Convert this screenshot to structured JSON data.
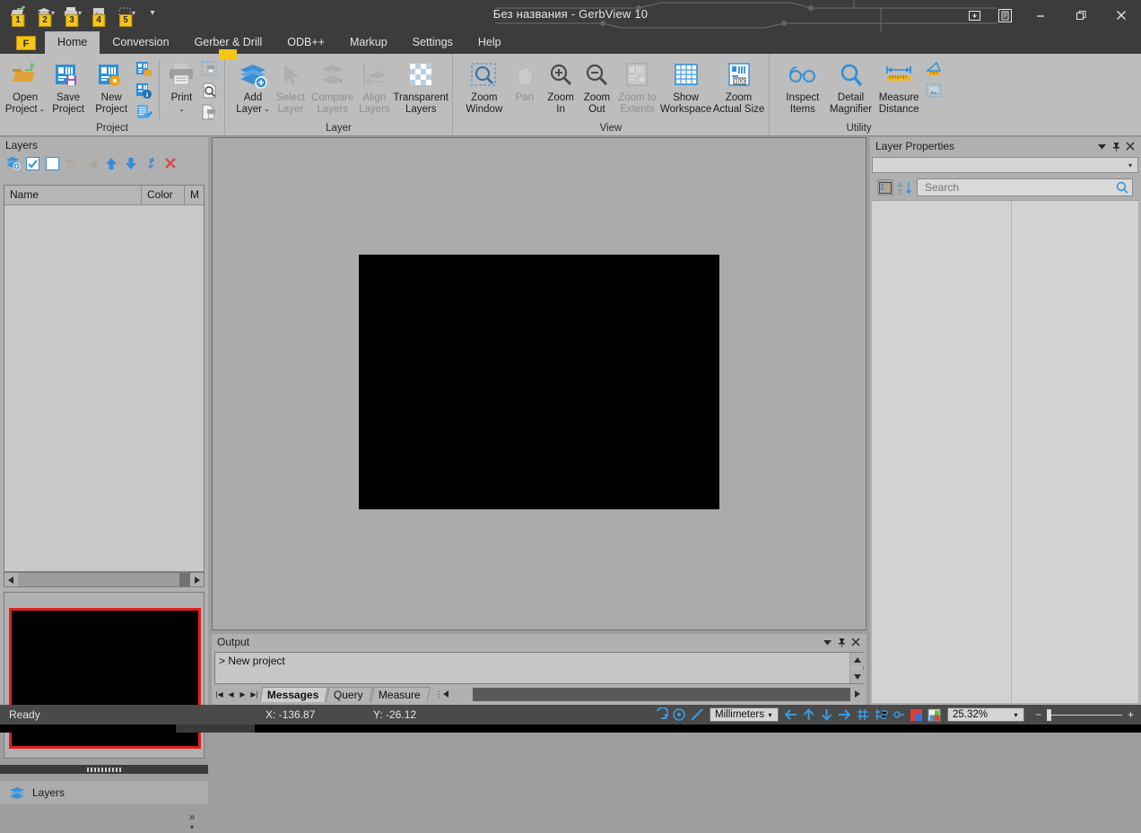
{
  "window": {
    "title": "Без названия - GerbView 10",
    "quick_access": [
      {
        "name": "open",
        "keytip": "1",
        "icon": "open-folder-icon",
        "has_caret": false
      },
      {
        "name": "save",
        "keytip": "2",
        "icon": "save-layers-icon",
        "has_caret": true
      },
      {
        "name": "print",
        "keytip": "3",
        "icon": "printer-icon",
        "has_caret": true
      },
      {
        "name": "export",
        "keytip": "4",
        "icon": "export-image-icon",
        "has_caret": false
      },
      {
        "name": "select",
        "keytip": "5",
        "icon": "select-rect-icon",
        "has_caret": true
      },
      {
        "name": "customize",
        "keytip": "",
        "icon": "chevron-down-icon",
        "has_caret": false
      }
    ],
    "controls": {
      "ribbon_display": "ribbon-display-icon",
      "ribbon_pin": "ribbon-pin-icon",
      "minimize": "minimize-icon",
      "restore": "restore-icon",
      "close": "close-icon"
    }
  },
  "ribbon": {
    "file_keytip": "F",
    "tabs": [
      {
        "label": "Home",
        "active": true,
        "keytip": ""
      },
      {
        "label": "Conversion",
        "active": false,
        "keytip": ""
      },
      {
        "label": "Gerber & Drill",
        "active": false,
        "keytip": ""
      },
      {
        "label": "ODB++",
        "active": false,
        "keytip": ""
      },
      {
        "label": "Markup",
        "active": false,
        "keytip": ""
      },
      {
        "label": "Settings",
        "active": false,
        "keytip": ""
      },
      {
        "label": "Help",
        "active": false,
        "keytip": ""
      }
    ],
    "groups": [
      {
        "title": "Project",
        "buttons": [
          {
            "label": "Open\nProject",
            "line1": "Open",
            "line2": "Project",
            "icon": "open-project-icon",
            "caret": true,
            "disabled": false
          },
          {
            "label": "Save Project",
            "line1": "Save",
            "line2": "Project",
            "icon": "save-project-icon",
            "caret": false,
            "disabled": false
          },
          {
            "label": "New Project",
            "line1": "New",
            "line2": "Project",
            "icon": "new-project-icon",
            "caret": false,
            "disabled": false
          }
        ],
        "small_buttons": [
          "project-files-icon",
          "project-info-icon",
          "project-notes-icon"
        ],
        "buttons2": [
          {
            "line1": "Print",
            "line2": "",
            "icon": "print-icon",
            "caret": true,
            "disabled": false
          }
        ],
        "small_buttons2": [
          "print-area-icon",
          "print-preview-icon",
          "print-to-file-icon"
        ]
      },
      {
        "title": "Layer",
        "buttons": [
          {
            "line1": "Add",
            "line2": "Layer",
            "icon": "add-layer-icon",
            "caret": true,
            "disabled": false
          },
          {
            "line1": "Select",
            "line2": "Layer",
            "icon": "select-layer-icon",
            "caret": false,
            "disabled": true
          },
          {
            "line1": "Compare",
            "line2": "Layers",
            "icon": "compare-layers-icon",
            "caret": false,
            "disabled": true
          },
          {
            "line1": "Align",
            "line2": "Layers",
            "icon": "align-layers-icon",
            "caret": false,
            "disabled": true
          },
          {
            "line1": "Transparent",
            "line2": "Layers",
            "icon": "transparent-layers-icon",
            "caret": false,
            "disabled": false
          }
        ]
      },
      {
        "title": "View",
        "buttons": [
          {
            "line1": "Zoom",
            "line2": "Window",
            "icon": "zoom-window-icon",
            "caret": false,
            "disabled": false
          },
          {
            "line1": "Pan",
            "line2": "",
            "icon": "pan-hand-icon",
            "caret": false,
            "disabled": true
          },
          {
            "line1": "Zoom",
            "line2": "In",
            "icon": "zoom-in-icon",
            "caret": false,
            "disabled": false
          },
          {
            "line1": "Zoom",
            "line2": "Out",
            "icon": "zoom-out-icon",
            "caret": false,
            "disabled": false
          },
          {
            "line1": "Zoom to",
            "line2": "Extents",
            "icon": "zoom-extents-icon",
            "caret": false,
            "disabled": true
          },
          {
            "line1": "Show",
            "line2": "Workspace",
            "icon": "show-workspace-icon",
            "caret": false,
            "disabled": false
          },
          {
            "line1": "Zoom",
            "line2": "Actual Size",
            "icon": "zoom-actual-size-icon",
            "caret": false,
            "disabled": false
          }
        ]
      },
      {
        "title": "Utility",
        "buttons": [
          {
            "line1": "Inspect",
            "line2": "Items",
            "icon": "inspect-items-icon",
            "caret": false,
            "disabled": false
          },
          {
            "line1": "Detail",
            "line2": "Magnifier",
            "icon": "detail-magnifier-icon",
            "caret": false,
            "disabled": false
          },
          {
            "line1": "Measure",
            "line2": "Distance",
            "icon": "measure-distance-icon",
            "caret": false,
            "disabled": false
          }
        ],
        "small_buttons": [
          "measure-angle-icon",
          "measure-area-icon"
        ]
      }
    ]
  },
  "layers_panel": {
    "title": "Layers",
    "toolbar": [
      {
        "name": "add-layer-icon",
        "disabled": false
      },
      {
        "name": "show-all-layers-icon",
        "disabled": false
      },
      {
        "name": "hide-all-layers-icon",
        "disabled": false
      },
      {
        "name": "group-layers-icon",
        "disabled": true
      },
      {
        "name": "ungroup-layers-icon",
        "disabled": true
      },
      {
        "name": "move-layer-up-icon",
        "disabled": false
      },
      {
        "name": "move-layer-down-icon",
        "disabled": false
      },
      {
        "name": "layer-properties-icon",
        "disabled": false
      },
      {
        "name": "delete-layer-icon",
        "disabled": false
      }
    ],
    "columns": [
      "Name",
      "Color",
      "M"
    ],
    "rows": [],
    "dock_tab": "Layers",
    "overflow": "»"
  },
  "layer_properties_panel": {
    "title": "Layer Properties",
    "combo_value": "",
    "search": {
      "value": "",
      "placeholder": "Search"
    },
    "tools": [
      "categorized-view-icon",
      "alphabetical-sort-icon"
    ],
    "rows": []
  },
  "output_panel": {
    "title": "Output",
    "messages": [
      "> New project"
    ],
    "tabs": [
      {
        "label": "Messages",
        "active": true
      },
      {
        "label": "Query",
        "active": false
      },
      {
        "label": "Measure",
        "active": false
      }
    ]
  },
  "status_bar": {
    "state": "Ready",
    "coord_x": "X: -136.87",
    "coord_y": "Y: -26.12",
    "units": "Millimeters",
    "zoom": "25.32%",
    "zoom_out_label": "−",
    "zoom_in_label": "+",
    "icons": [
      "arc-mode-icon",
      "circle-mode-icon",
      "line-mode-icon",
      "pan-left-icon",
      "pan-up-icon",
      "pan-down-icon",
      "pan-right-icon",
      "grid-icon",
      "snap-grid-icon",
      "snap-point-icon",
      "color-swatch-icon",
      "image-swatch-icon"
    ]
  },
  "colors": {
    "titlebar": "#3c3c3c",
    "ribbon": "#bdbdbd",
    "accent_blue": "#3399e0",
    "keytip_yellow": "#f5c518",
    "overview_border": "#e02020",
    "artboard": "#000000",
    "canvas": "#ababab"
  }
}
